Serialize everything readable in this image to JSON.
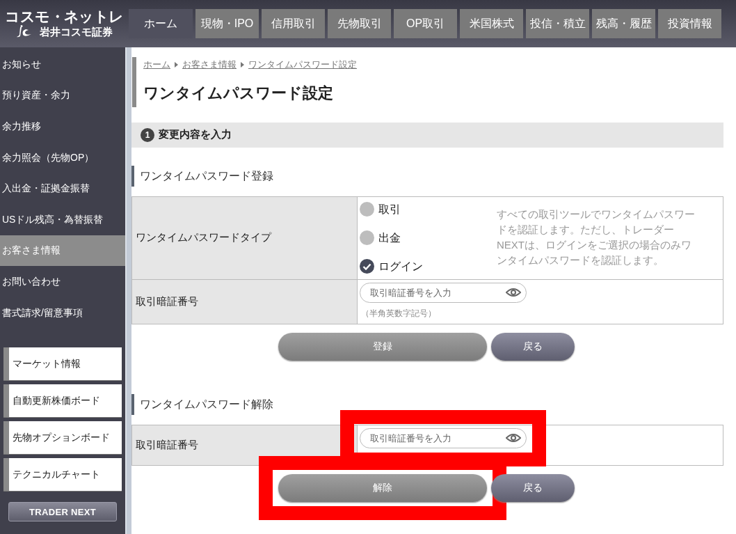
{
  "header": {
    "logo": {
      "brand": "コスモ・ネットレ",
      "company": "岩井コスモ証券"
    },
    "nav_tabs": [
      {
        "label": "ホーム",
        "selected": true
      },
      {
        "label": "現物・IPO",
        "selected": false
      },
      {
        "label": "信用取引",
        "selected": false
      },
      {
        "label": "先物取引",
        "selected": false
      },
      {
        "label": "OP取引",
        "selected": false
      },
      {
        "label": "米国株式",
        "selected": false
      },
      {
        "label": "投信・積立",
        "selected": false
      },
      {
        "label": "残高・履歴",
        "selected": false
      },
      {
        "label": "投資情報",
        "selected": false
      }
    ]
  },
  "sidebar": {
    "items": [
      {
        "label": "お知らせ",
        "selected": false
      },
      {
        "label": "預り資産・余力",
        "selected": false
      },
      {
        "label": "余力推移",
        "selected": false
      },
      {
        "label": "余力照会（先物OP）",
        "selected": false
      },
      {
        "label": "入出金・証拠金振替",
        "selected": false
      },
      {
        "label": "USドル残高・為替振替",
        "selected": false
      },
      {
        "label": "お客さま情報",
        "selected": true
      },
      {
        "label": "お問い合わせ",
        "selected": false
      },
      {
        "label": "書式請求/留意事項",
        "selected": false
      }
    ],
    "tool_links": [
      "マーケット情報",
      "自動更新株価ボード",
      "先物オプションボード",
      "テクニカルチャート"
    ],
    "trader_next_button": "TRADER NEXT"
  },
  "breadcrumb": [
    "ホーム",
    "お客さま情報",
    "ワンタイムパスワード設定"
  ],
  "title": "ワンタイムパスワード設定",
  "step": {
    "number": "1",
    "label": "変更内容を入力"
  },
  "sections": [
    {
      "heading": "ワンタイムパスワード登録",
      "rows": [
        {
          "kind": "radio",
          "label": "ワンタイムパスワードタイプ",
          "options": [
            {
              "label": "取引",
              "selected": false
            },
            {
              "label": "出金",
              "selected": false
            },
            {
              "label": "ログイン",
              "selected": true
            }
          ],
          "note": "すべての取引ツールでワンタイムパスワードを認証します。ただし、トレーダーNEXTは、ログインをご選択の場合のみワンタイムパスワードを認証します。"
        },
        {
          "kind": "password",
          "label": "取引暗証番号",
          "placeholder": "取引暗証番号を入力",
          "hint": "（半角英数字記号）",
          "highlighted": false
        }
      ],
      "buttons": [
        {
          "kind": "primary",
          "label": "登録",
          "highlighted": false
        },
        {
          "kind": "back",
          "label": "戻る",
          "highlighted": false
        }
      ]
    },
    {
      "heading": "ワンタイムパスワード解除",
      "rows": [
        {
          "kind": "password",
          "label": "取引暗証番号",
          "placeholder": "取引暗証番号を入力",
          "highlighted": true
        }
      ],
      "buttons": [
        {
          "kind": "primary",
          "label": "解除",
          "highlighted": true
        },
        {
          "kind": "back",
          "label": "戻る",
          "highlighted": false
        }
      ]
    }
  ]
}
